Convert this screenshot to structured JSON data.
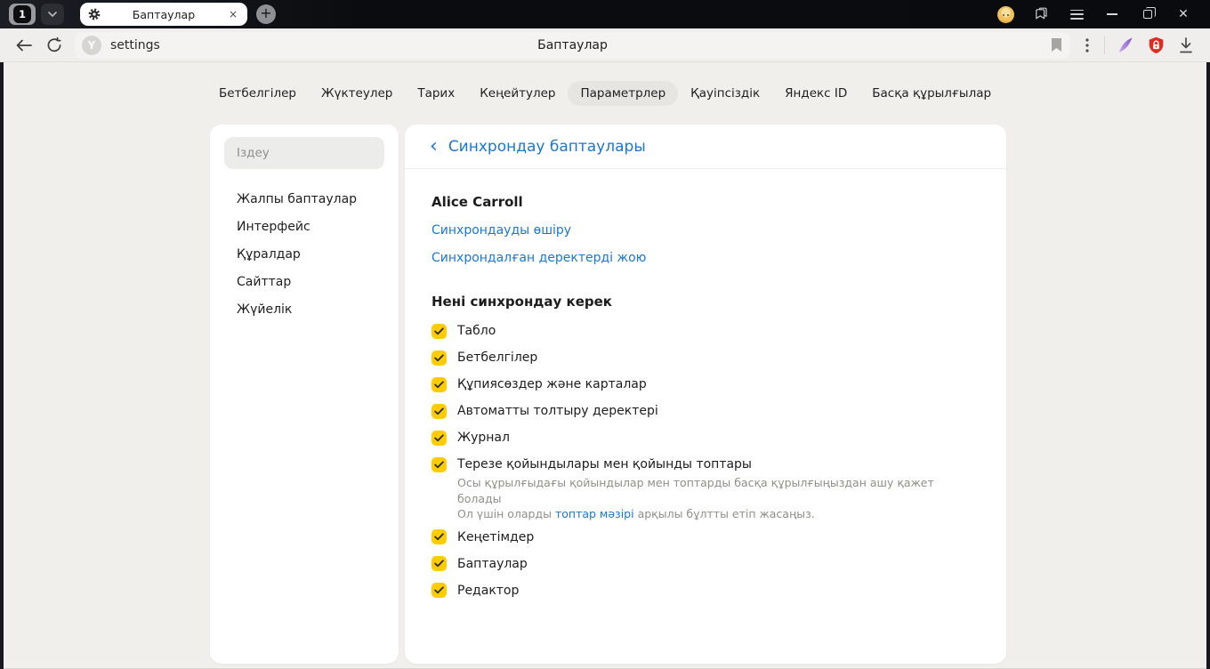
{
  "titlebar": {
    "tab_count": "1",
    "tab_title": "Баптаулар",
    "new_tab_glyph": "+",
    "tab_close_glyph": "×",
    "window_close_glyph": "✕"
  },
  "toolbar": {
    "address": "settings",
    "page_title": "Баптаулар",
    "protect_badge_glyph": "Y"
  },
  "nav": {
    "tabs": [
      {
        "label": "Бетбелгілер",
        "active": false
      },
      {
        "label": "Жүктеулер",
        "active": false
      },
      {
        "label": "Тарих",
        "active": false
      },
      {
        "label": "Кеңейтулер",
        "active": false
      },
      {
        "label": "Параметрлер",
        "active": true
      },
      {
        "label": "Қауіпсіздік",
        "active": false
      },
      {
        "label": "Яндекс ID",
        "active": false
      },
      {
        "label": "Басқа құрылғылар",
        "active": false
      }
    ]
  },
  "sidebar": {
    "search_placeholder": "Іздеу",
    "items": [
      {
        "label": "Жалпы баптаулар"
      },
      {
        "label": "Интерфейс"
      },
      {
        "label": "Құралдар"
      },
      {
        "label": "Сайттар"
      },
      {
        "label": "Жүйелік"
      }
    ]
  },
  "main": {
    "back_glyph": "‹",
    "header_title": "Синхрондау баптаулары",
    "account": {
      "name": "Alice Carroll",
      "links": [
        "Синхрондауды өшіру",
        "Синхрондалған деректерді жою"
      ]
    },
    "sync_section": {
      "title": "Нені синхрондау керек",
      "items": [
        {
          "label": "Табло",
          "checked": true
        },
        {
          "label": "Бетбелгілер",
          "checked": true
        },
        {
          "label": "Құпиясөздер және карталар",
          "checked": true
        },
        {
          "label": "Автоматты толтыру деректері",
          "checked": true
        },
        {
          "label": "Журнал",
          "checked": true
        },
        {
          "label": "Терезе қойындылары мен қойынды топтары",
          "checked": true,
          "description_line1": "Осы құрылғыдағы қойындылар мен топтарды басқа құрылғыңыздан ашу қажет болады",
          "description_line2_pre": "Ол үшін оларды ",
          "description_link": "топтар мәзірі",
          "description_line2_post": " арқылы бұлтты етіп жасаңыз."
        },
        {
          "label": "Кеңетімдер",
          "checked": true
        },
        {
          "label": "Баптаулар",
          "checked": true
        },
        {
          "label": "Редактор",
          "checked": true
        }
      ]
    }
  },
  "colors": {
    "accent_blue": "#1a78d2",
    "checkbox_yellow": "#ffcc00",
    "shield_red": "#e02b20",
    "quill_purple": "#9a6fdb"
  }
}
